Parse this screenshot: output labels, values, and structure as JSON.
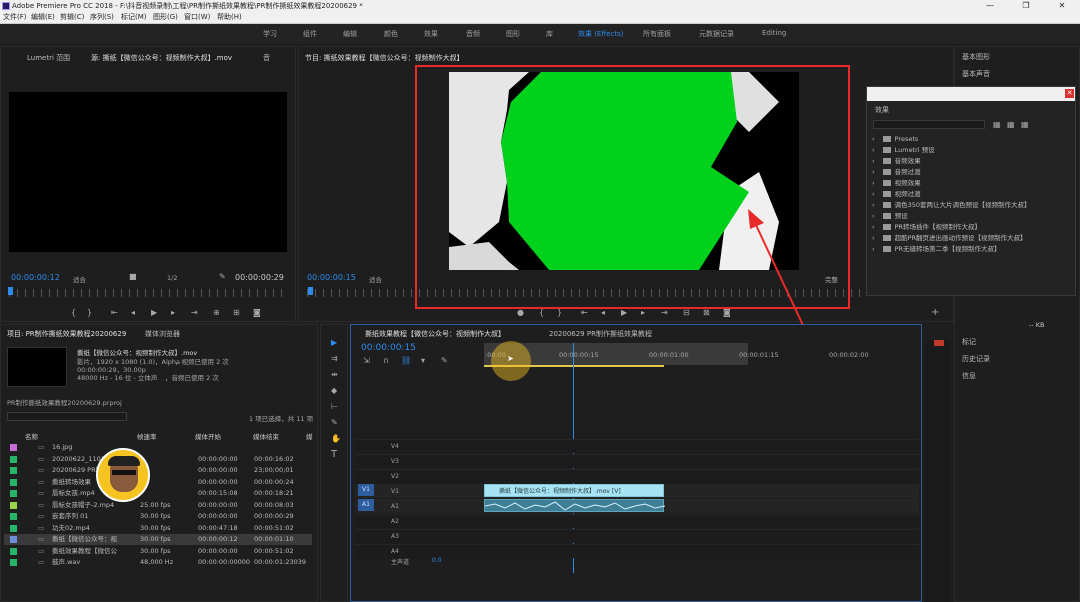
{
  "titlebar": {
    "title": "Adobe Premiere Pro CC 2018 - F:\\抖音视频录制\\工程\\PR制作撕纸效果教程\\PR制作撕纸效果教程20200629 *",
    "min": "—",
    "max": "❐",
    "close": "✕"
  },
  "menu": [
    "文件(F)",
    "编辑(E)",
    "剪辑(C)",
    "序列(S)",
    "标记(M)",
    "图形(G)",
    "窗口(W)",
    "帮助(H)"
  ],
  "workspaces": [
    "学习",
    "组件",
    "编辑",
    "颜色",
    "效果",
    "音频",
    "图形",
    "库",
    "效果 (Effects)",
    "所有面板",
    "元数据记录",
    "Editing"
  ],
  "source": {
    "tabs": [
      "Lumetri 范围",
      "源: 撕纸【微信公众号：视频制作大叔】.mov",
      "音"
    ],
    "timecode_in": "00:00:00:12",
    "fit": "适合",
    "ratio": "1/2",
    "timecode_out": "00:00:00:29"
  },
  "program": {
    "tab": "节目: 撕纸效果教程【微信公众号：视频制作大叔】",
    "timecode_in": "00:00:00:15",
    "fit": "适合",
    "complete": "完整",
    "green": "#00d21c"
  },
  "right_panel": {
    "items": [
      "基本图形",
      "基本声音"
    ],
    "lower": [
      "标记",
      "历史记录",
      "信息"
    ],
    "kb": "-- KB"
  },
  "effects": {
    "title": "效果",
    "items": [
      "Presets",
      "Lumetri 预设",
      "音频效果",
      "音频过渡",
      "视频效果",
      "视频过渡",
      "调色350套两让大片调色预设【视频制作大叔】",
      "预设",
      "PR转场插件【视频制作大叔】",
      "超酷PR翻页进出画动作预设【视频制作大叔】",
      "PR无缝转场第二季【视频制作大叔】"
    ]
  },
  "project": {
    "tabs": [
      "项目: PR制作撕纸效果教程20200629",
      "媒体浏览器"
    ],
    "clip_name": "撕纸【微信公众号：视频制作大叔】.mov",
    "clip_info1": "影片，1920 x 1080 (1.0)，Alpha",
    "clip_info1b": "，视频已使用 2 次",
    "clip_info2": "00:00:00:29，30.00p",
    "clip_info3": "48000 Hz - 16 位 - 立体声",
    "clip_info3b": "，音频已使用 2 次",
    "file": "PR制作撕纸效果教程20200629.prproj",
    "selected": "1 项已选择，共 11 项",
    "columns": [
      "名称",
      "帧速率",
      "媒体开始",
      "媒体结束",
      "媒"
    ],
    "rows": [
      {
        "name": "16.jpg",
        "fps": "",
        "start": "",
        "end": "",
        "color": "#c76bd6"
      },
      {
        "name": "20200622_110129.mp",
        "fps": "",
        "start": "00:00:00:00",
        "end": "00:00:16:02",
        "color": "#28b56a"
      },
      {
        "name": "20200629 PR制",
        "fps": "",
        "start": "00:00:00:00",
        "end": "23;00;00;01",
        "color": "#28b56a"
      },
      {
        "name": "撕纸转场效果",
        "fps": "",
        "start": "00:00:00:00",
        "end": "00:00:00:24",
        "color": "#28b56a"
      },
      {
        "name": "唇标女孩.mp4",
        "fps": "",
        "start": "00:00:15:08",
        "end": "00:00:18:21",
        "color": "#28b56a"
      },
      {
        "name": "唇标女孩帽子-2.mp4",
        "fps": "25.00 fps",
        "start": "00:00:00:00",
        "end": "00:00:08:03",
        "color": "#9bd14b"
      },
      {
        "name": "嵌套序列 01",
        "fps": "30.00 fps",
        "start": "00:00:00:00",
        "end": "00:00:00:29",
        "color": "#28b56a"
      },
      {
        "name": "功夫02.mp4",
        "fps": "30.00 fps",
        "start": "00:00:47:18",
        "end": "00:00:51:02",
        "color": "#28b56a"
      },
      {
        "name": "撕纸【微信公众号：视",
        "fps": "30.00 fps",
        "start": "00:00:00:12",
        "end": "00:00:01:10",
        "color": "#6c8ed8"
      },
      {
        "name": "撕纸效果教程【微信公",
        "fps": "30.00 fps",
        "start": "00:00:00:00",
        "end": "00:00:51:02",
        "color": "#28b56a"
      },
      {
        "name": "鼓声.wav",
        "fps": "48,000 Hz",
        "start": "00:00:00:00000",
        "end": "00:00:01:23039",
        "color": "#28b56a"
      }
    ]
  },
  "timeline": {
    "tabs": [
      "撕纸效果教程【微信公众号：视频制作大叔】",
      "20200629 PR制作撕纸效果教程"
    ],
    "timecode": "00:00:00:15",
    "ruler": [
      ":00:00",
      "00:00:00:15",
      "00:00:01:00",
      "00:00:01:15",
      "00:00:02:00"
    ],
    "video_tracks": [
      "V4",
      "V3",
      "V2",
      "V1"
    ],
    "audio_tracks": [
      "A1",
      "A2",
      "A3",
      "A4"
    ],
    "master": "主声道",
    "master_val": "0.0",
    "v1_label": "V1",
    "a1_label": "A1",
    "clip_v": "撕纸【微信公众号：视频制作大叔】.mov [V]",
    "clip_color": "#a6e4f5"
  }
}
